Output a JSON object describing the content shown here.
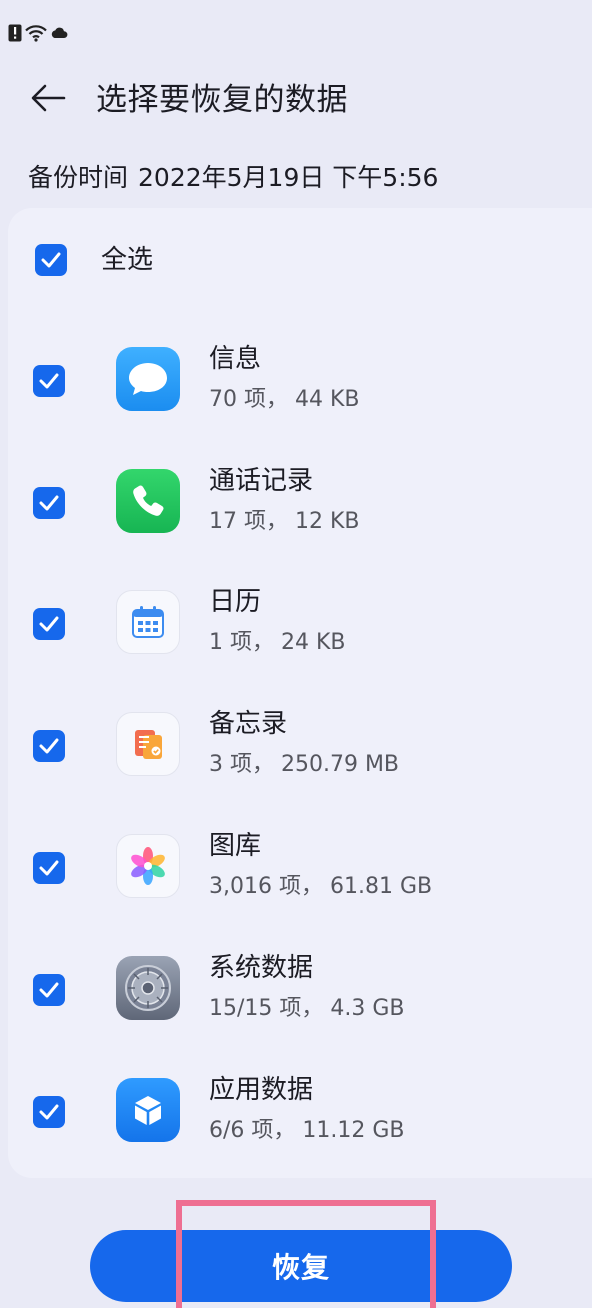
{
  "status_bar": {
    "icons": [
      "alert-icon",
      "wifi-icon",
      "cloud-icon"
    ]
  },
  "header": {
    "title": "选择要恢复的数据"
  },
  "backup_time": {
    "label": "备份时间",
    "value": "2022年5月19日 下午5:56"
  },
  "select_all": {
    "label": "全选",
    "checked": true
  },
  "items": [
    {
      "name": "信息",
      "detail": "70 项， 44 KB",
      "icon": "messages-icon",
      "checked": true
    },
    {
      "name": "通话记录",
      "detail": "17 项， 12 KB",
      "icon": "phone-icon",
      "checked": true
    },
    {
      "name": "日历",
      "detail": "1 项， 24 KB",
      "icon": "calendar-icon",
      "checked": true
    },
    {
      "name": "备忘录",
      "detail": "3 项， 250.79 MB",
      "icon": "notes-icon",
      "checked": true
    },
    {
      "name": "图库",
      "detail": "3,016 项， 61.81 GB",
      "icon": "gallery-icon",
      "checked": true
    },
    {
      "name": "系统数据",
      "detail": "15/15 项， 4.3 GB",
      "icon": "system-settings-icon",
      "checked": true
    },
    {
      "name": "应用数据",
      "detail": "6/6 项， 11.12 GB",
      "icon": "app-data-icon",
      "checked": true
    }
  ],
  "restore_button": {
    "label": "恢复"
  },
  "colors": {
    "accent": "#1668ec",
    "background": "#e9eaf6",
    "highlight": "#ee6f92"
  }
}
